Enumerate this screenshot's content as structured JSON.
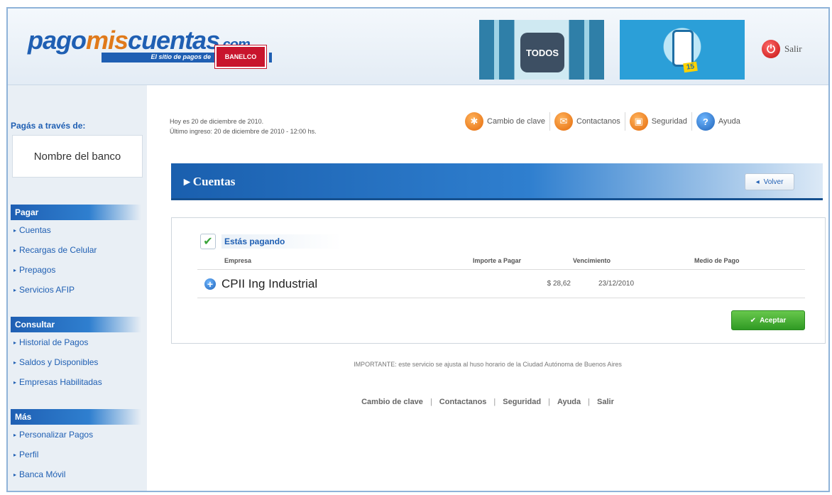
{
  "header": {
    "logo_part1": "pago",
    "logo_part2": "mis",
    "logo_part3": "cuentas",
    "logo_domain": ".com",
    "logo_tagline": "El sitio de pagos de",
    "banelco": "BANELCO",
    "banner1_text": "TODOS",
    "banner2_tag": "15",
    "salir": "Salir"
  },
  "sidebar": {
    "paga_title": "Pagás a través de:",
    "bank_name": "Nombre del banco",
    "sections": [
      {
        "title": "Pagar",
        "items": [
          "Cuentas",
          "Recargas de Celular",
          "Prepagos",
          "Servicios AFIP"
        ]
      },
      {
        "title": "Consultar",
        "items": [
          "Historial de Pagos",
          "Saldos y Disponibles",
          "Empresas Habilitadas"
        ]
      },
      {
        "title": "Más",
        "items": [
          "Personalizar Pagos",
          "Perfil",
          "Banca Móvil"
        ]
      }
    ]
  },
  "main": {
    "date_line1": "Hoy es 20 de diciembre de 2010.",
    "date_line2": "Último ingreso: 20 de diciembre de 2010 - 12:00 hs.",
    "toplinks": {
      "cambio": "Cambio de clave",
      "contactanos": "Contactanos",
      "seguridad": "Seguridad",
      "ayuda": "Ayuda"
    },
    "section_title": "Cuentas",
    "volver": "Volver",
    "paying_label": "Estás pagando",
    "table": {
      "headers": {
        "empresa": "Empresa",
        "importe": "Importe a Pagar",
        "vencimiento": "Vencimiento",
        "medio": "Medio de Pago"
      },
      "rows": [
        {
          "empresa": "CPII Ing Industrial",
          "importe": "$ 28,62",
          "vencimiento": "23/12/2010",
          "medio": ""
        }
      ]
    },
    "aceptar": "Aceptar",
    "important": "IMPORTANTE: este servicio se ajusta al huso horario de la Ciudad Autónoma de Buenos Aires",
    "footer": {
      "cambio": "Cambio de clave",
      "contactanos": "Contactanos",
      "seguridad": "Seguridad",
      "ayuda": "Ayuda",
      "salir": "Salir",
      "separator": "|"
    }
  }
}
